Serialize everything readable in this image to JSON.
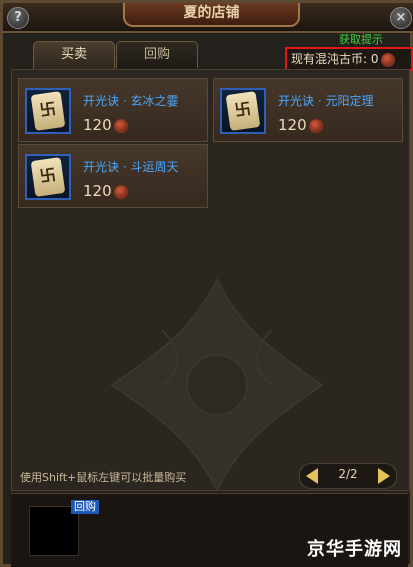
{
  "window": {
    "title": "夏的店铺",
    "help": "?",
    "close": "×"
  },
  "tabs": [
    {
      "label": "买卖"
    },
    {
      "label": "回购"
    }
  ],
  "currency": {
    "tip": "获取提示",
    "label": "现有混沌古币: 0"
  },
  "items": [
    {
      "name": "开光诀 · 玄冰之霎",
      "price": "120"
    },
    {
      "name": "开光诀 · 元阳定理",
      "price": "120"
    },
    {
      "name": "开光诀 · 斗运周天",
      "price": "120"
    }
  ],
  "footer": {
    "hint": "使用Shift+鼠标左键可以批量购买",
    "page": "2/2",
    "buyback_label": "回购"
  },
  "brand": "京华手游网",
  "colors": {
    "item_name": "#4aa7ff",
    "tip": "#3fd43f",
    "highlight_border": "#e01818"
  }
}
